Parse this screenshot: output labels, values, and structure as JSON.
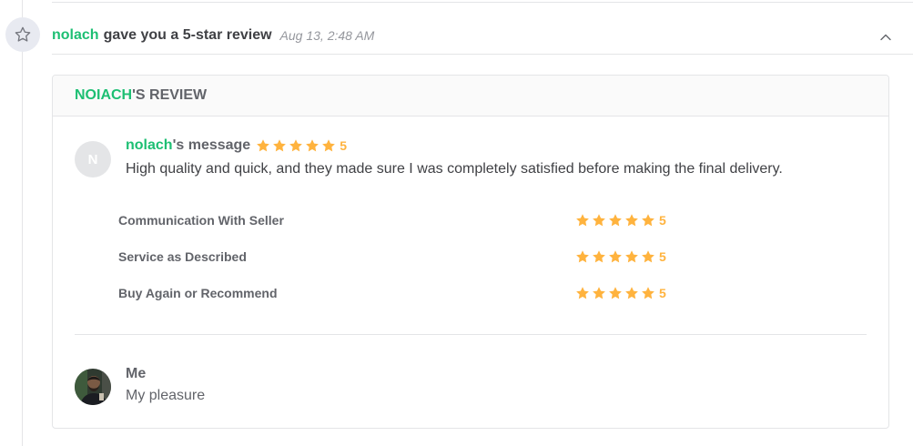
{
  "event": {
    "icon": "star-outline-icon",
    "username": "nolach",
    "text": "gave you a 5-star review",
    "timestamp": "Aug 13, 2:48 AM",
    "collapse_icon": "chevron-up-icon"
  },
  "review": {
    "heading_user": "NOIACH",
    "heading_suffix": "'S REVIEW",
    "avatar_initial": "N",
    "message_user": "nolach",
    "message_suffix": "'s message",
    "overall_rating": 5,
    "overall_rating_label": "5",
    "message": "High quality and quick, and they made sure I was completely satisfied before making the final delivery.",
    "sub_ratings": [
      {
        "label": "Communication With Seller",
        "rating": 5,
        "rating_label": "5"
      },
      {
        "label": "Service as Described",
        "rating": 5,
        "rating_label": "5"
      },
      {
        "label": "Buy Again or Recommend",
        "rating": 5,
        "rating_label": "5"
      }
    ]
  },
  "reply": {
    "name": "Me",
    "text": "My pleasure"
  },
  "colors": {
    "brand_green": "#1dbf73",
    "star_orange": "#ffb33e",
    "text_dark": "#404145",
    "text_muted": "#62646a"
  }
}
